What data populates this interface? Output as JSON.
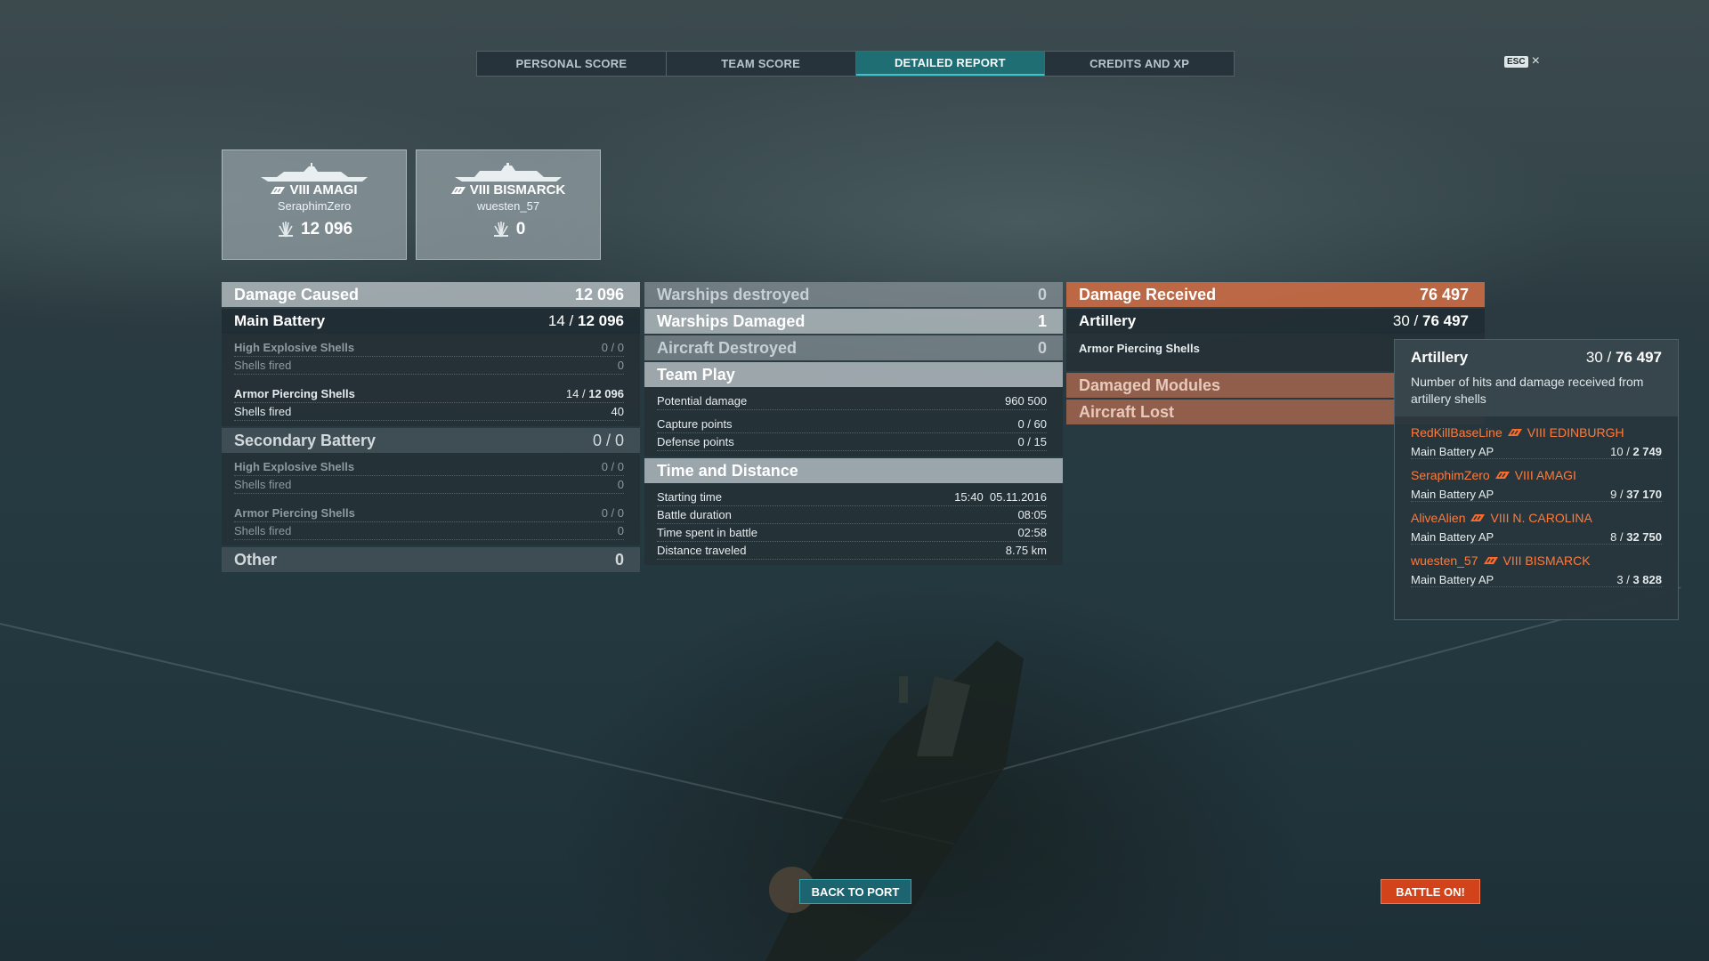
{
  "tabs": [
    {
      "label": "PERSONAL SCORE",
      "active": false
    },
    {
      "label": "TEAM SCORE",
      "active": false
    },
    {
      "label": "DETAILED REPORT",
      "active": true
    },
    {
      "label": "CREDITS AND XP",
      "active": false
    }
  ],
  "close": {
    "key": "ESC",
    "icon": "×"
  },
  "cards": [
    {
      "ship": "VIII AMAGI",
      "player": "SeraphimZero",
      "score": "12 096"
    },
    {
      "ship": "VIII BISMARCK",
      "player": "wuesten_57",
      "score": "0"
    }
  ],
  "damage_caused": {
    "title": "Damage Caused",
    "value": "12 096",
    "main_battery": {
      "title": "Main Battery",
      "hits": "14",
      "value": "12 096"
    },
    "mb_rows": [
      {
        "label": "High Explosive Shells",
        "value": "0 / 0"
      },
      {
        "label": "Shells fired",
        "value": "0"
      },
      {
        "label": "Armor Piercing Shells",
        "hits": "14",
        "value": "12 096"
      },
      {
        "label": "Shells fired",
        "value": "40"
      }
    ],
    "secondary": {
      "title": "Secondary Battery",
      "value": "0 / 0"
    },
    "sec_rows": [
      {
        "label": "High Explosive Shells",
        "value": "0 / 0"
      },
      {
        "label": "Shells fired",
        "value": "0"
      },
      {
        "label": "Armor Piercing Shells",
        "value": "0 / 0"
      },
      {
        "label": "Shells fired",
        "value": "0"
      }
    ],
    "other": {
      "title": "Other",
      "value": "0"
    }
  },
  "middle": {
    "warships_destroyed": {
      "title": "Warships destroyed",
      "value": "0"
    },
    "warships_damaged": {
      "title": "Warships Damaged",
      "value": "1"
    },
    "aircraft_destroyed": {
      "title": "Aircraft Destroyed",
      "value": "0"
    },
    "team_play": {
      "title": "Team Play"
    },
    "team_rows": [
      {
        "label": "Potential damage",
        "value": "960 500"
      },
      {
        "label": "Capture points",
        "value": "0 / 60"
      },
      {
        "label": "Defense points",
        "value": "0 / 15"
      }
    ],
    "time_distance": {
      "title": "Time and Distance"
    },
    "time_rows": [
      {
        "label": "Starting time",
        "value": "15:40  05.11.2016"
      },
      {
        "label": "Battle duration",
        "value": "08:05"
      },
      {
        "label": "Time spent in battle",
        "value": "02:58"
      },
      {
        "label": "Distance traveled",
        "value": "8.75 km"
      }
    ]
  },
  "damage_received": {
    "title": "Damage Received",
    "value": "76 497",
    "artillery": {
      "title": "Artillery",
      "hits": "30",
      "value": "76 497"
    },
    "ap_label": "Armor Piercing Shells",
    "damaged_modules": {
      "title": "Damaged Modules"
    },
    "aircraft_lost": {
      "title": "Aircraft Lost"
    }
  },
  "tooltip": {
    "title": "Artillery",
    "hits": "30",
    "value": "76 497",
    "description": "Number of hits and damage received from artillery shells",
    "entries": [
      {
        "player": "RedKillBaseLine",
        "ship": "VIII EDINBURGH",
        "type": "Main Battery AP",
        "hits": "10",
        "damage": "2 749"
      },
      {
        "player": "SeraphimZero",
        "ship": "VIII AMAGI",
        "type": "Main Battery AP",
        "hits": "9",
        "damage": "37 170"
      },
      {
        "player": "AliveAlien",
        "ship": "VIII N. CAROLINA",
        "type": "Main Battery AP",
        "hits": "8",
        "damage": "32 750"
      },
      {
        "player": "wuesten_57",
        "ship": "VIII BISMARCK",
        "type": "Main Battery AP",
        "hits": "3",
        "damage": "3 828"
      }
    ]
  },
  "buttons": {
    "back": "BACK TO PORT",
    "battle": "BATTLE ON!"
  },
  "colors": {
    "accent_tab": "#1f6e74",
    "damage_received": "#c86a44",
    "enemy_name": "#ff7a3a",
    "battle_button": "#d3431b"
  }
}
